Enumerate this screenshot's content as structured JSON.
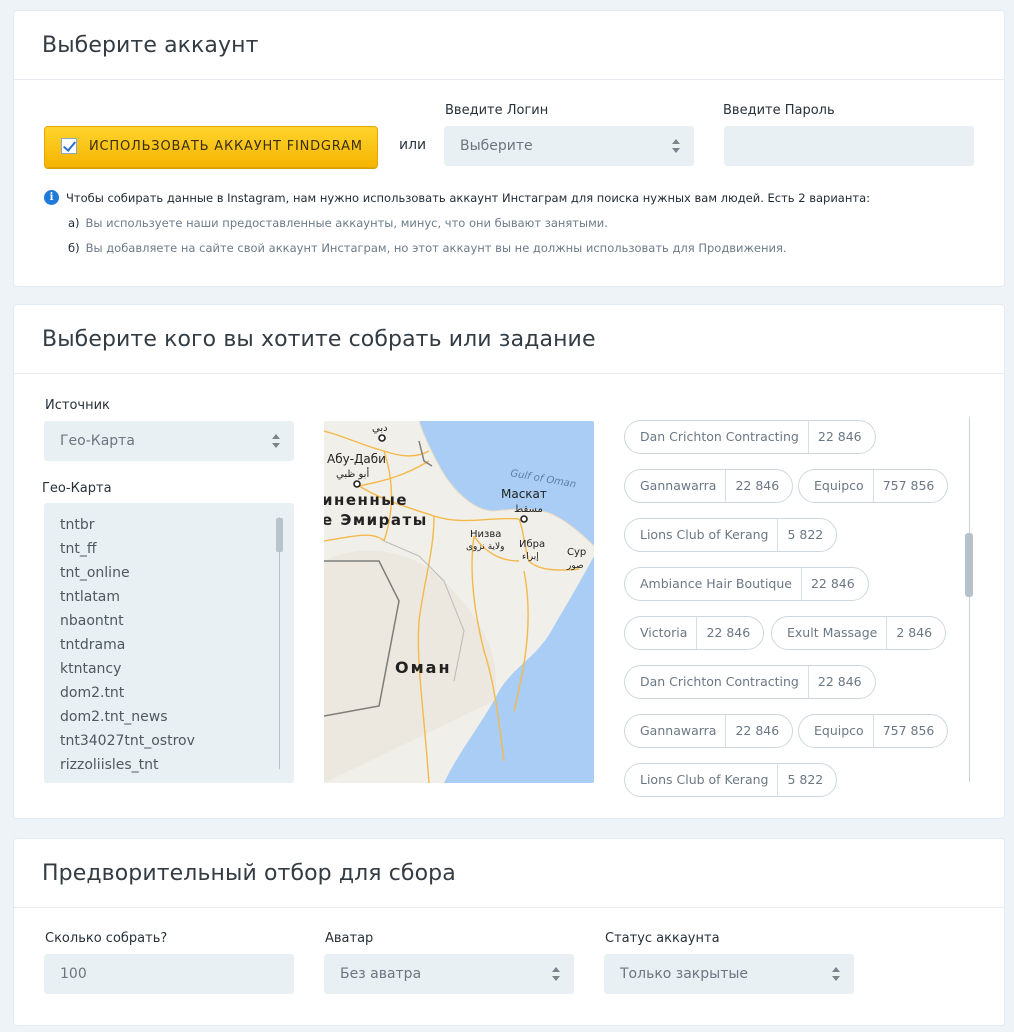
{
  "account": {
    "title": "Выберите аккаунт",
    "use_findgram_label": "ИСПОЛЬЗОВАТЬ АККАУНТ FINDGRAM",
    "or_label": "или",
    "login_label": "Введите Логин",
    "login_select_value": "Выберите",
    "password_label": "Введите Пароль",
    "password_value": "",
    "info_text": "Чтобы собирать данные в Instagram, нам нужно использовать аккаунт Инстаграм для поиска нужных вам людей. Есть 2 варианта:",
    "option_a_marker": "а)",
    "option_a_text": "Вы используете наши предоставленные аккаунты, минус, что они бывают занятыми.",
    "option_b_marker": "б)",
    "option_b_text": "Вы добавляете на сайте свой аккаунт Инстаграм, но этот аккаунт вы не должны использовать для Продвижения."
  },
  "source": {
    "title": "Выберите кого вы хотите собрать или задание",
    "source_label": "Источник",
    "source_value": "Гео-Карта",
    "geo_label": "Гео-Карта",
    "geo_items": [
      "tntbr",
      "tnt_ff",
      "tnt_online",
      "tntlatam",
      "nbaontnt",
      "tntdrama",
      "ktntancy",
      "dom2.tnt",
      "dom2.tnt_news",
      "tnt34027tnt_ostrov",
      "rizzoliisles_tnt"
    ],
    "map_labels": {
      "dubai": "دبي",
      "abu_dhabi": "Абу-Даби",
      "abu_dhabi_ar": "أبو ظبي",
      "uae_1": "иненные",
      "uae_2": "е Эмираты",
      "gulf": "Gulf of Oman",
      "muscat": "Маскат",
      "muscat_ar": "مسقط",
      "nizwa": "Низва",
      "nizwa_ar": "ولاية نزوى",
      "ibra": "Ибра",
      "ibra_ar": "إبراء",
      "sur": "Сур",
      "sur_ar": "صور",
      "oman": "Оман"
    },
    "tags": [
      {
        "name": "Dan Crichton Contracting",
        "count": "22 846"
      },
      {
        "name": "Gannawarra",
        "count": "22 846"
      },
      {
        "name": "Equipco",
        "count": "757 856"
      },
      {
        "name": "Lions Club of Kerang",
        "count": "5 822"
      },
      {
        "name": "Ambiance Hair Boutique",
        "count": "22 846"
      },
      {
        "name": "Victoria",
        "count": "22 846"
      },
      {
        "name": "Exult Massage",
        "count": "2 846"
      },
      {
        "name": "Dan Crichton Contracting",
        "count": "22 846"
      },
      {
        "name": "Gannawarra",
        "count": "22 846"
      },
      {
        "name": "Equipco",
        "count": "757 856"
      },
      {
        "name": "Lions Club of Kerang",
        "count": "5 822"
      }
    ]
  },
  "prefilter": {
    "title": "Предворительный отбор для сбора",
    "count_label": "Сколько собрать?",
    "count_value": "100",
    "avatar_label": "Аватар",
    "avatar_value": "Без аватра",
    "status_label": "Статус аккаунта",
    "status_value": "Только закрытые"
  },
  "colors": {
    "accent_yellow": "#f5b400",
    "field_bg": "#e9f0f3",
    "info_blue": "#1f7ad8",
    "water": "#a9cdf5"
  }
}
